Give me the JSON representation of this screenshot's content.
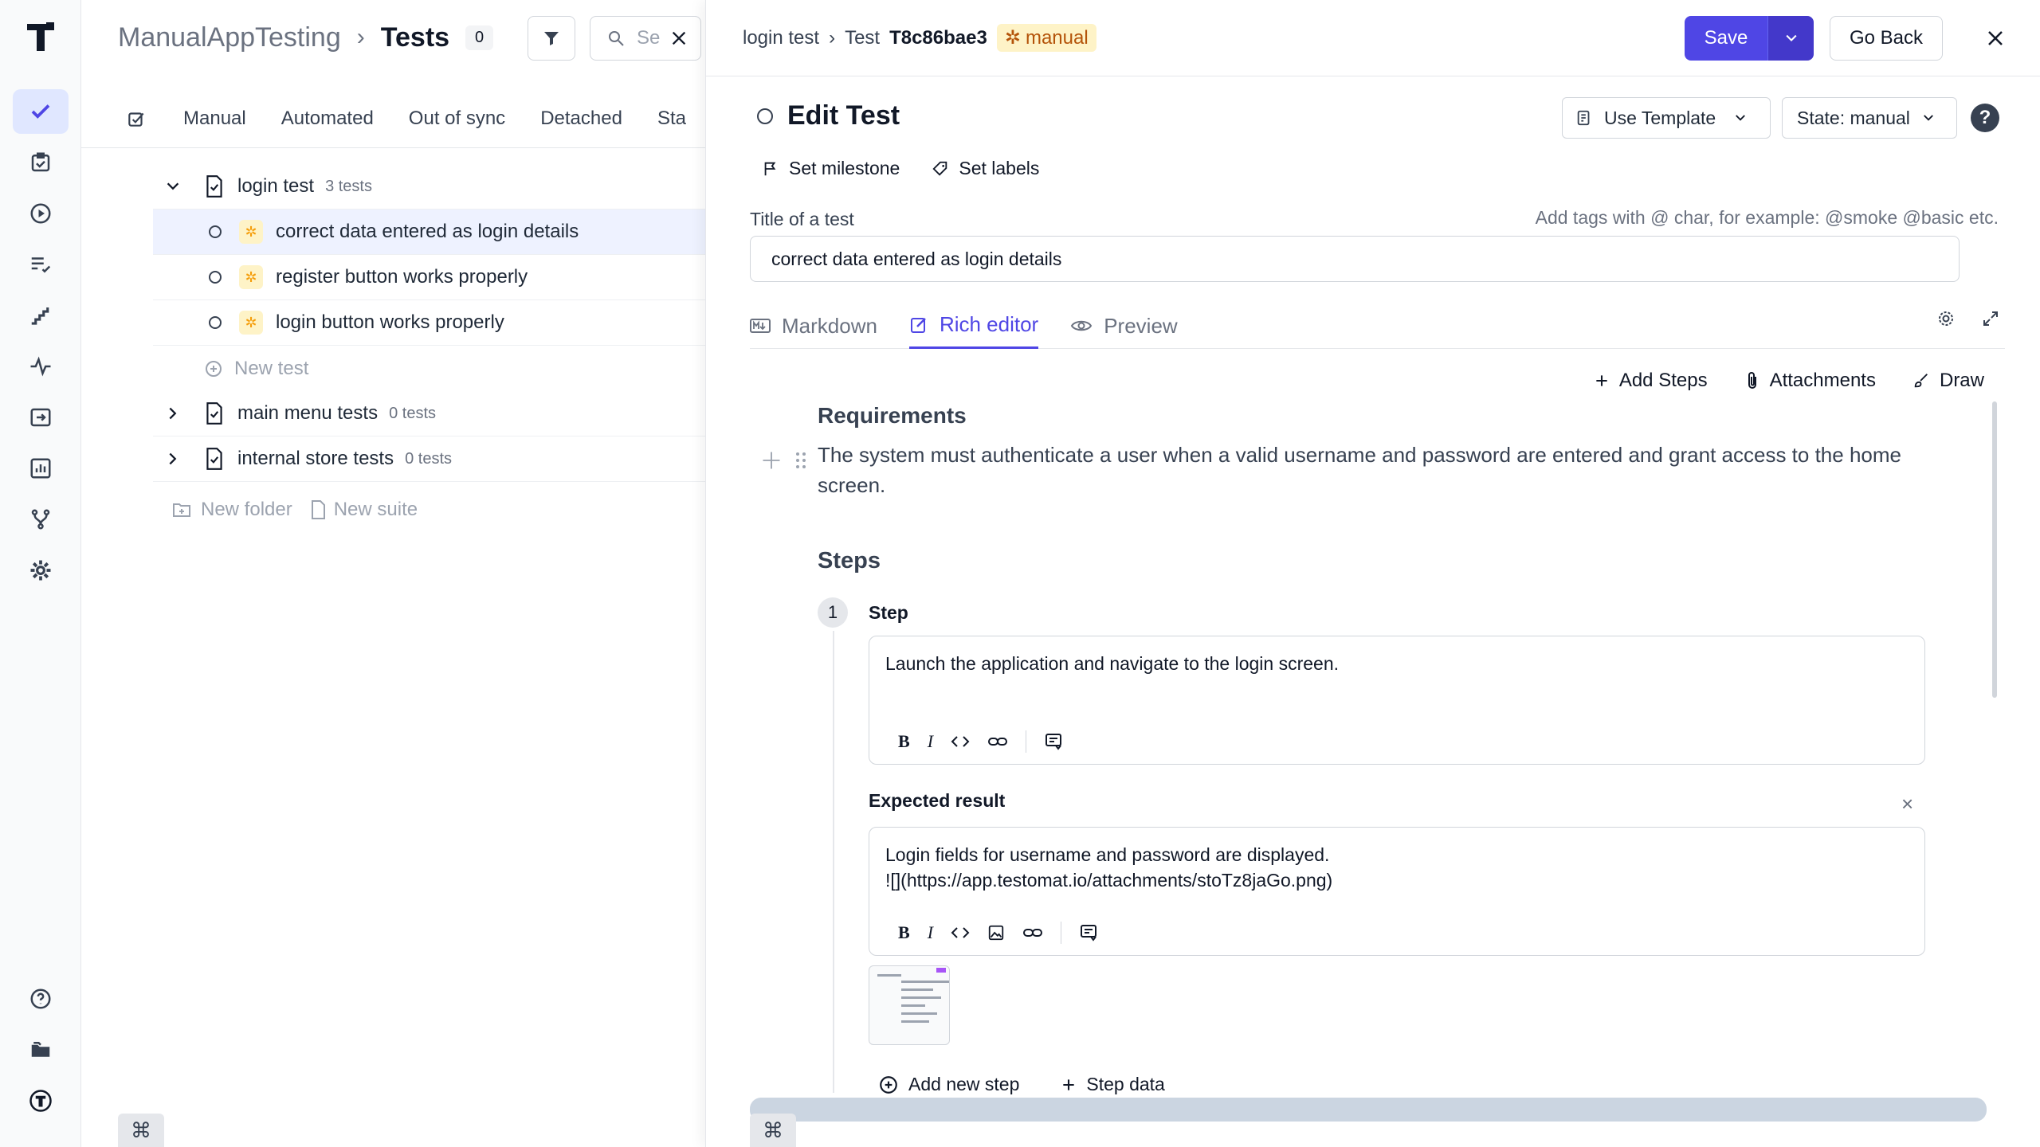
{
  "sidebar": {
    "items": [
      "tests-icon",
      "runs-icon",
      "play-icon",
      "list-icon",
      "steps-icon",
      "pulse-icon",
      "import-icon",
      "analytics-icon",
      "branch-icon",
      "settings-icon"
    ],
    "bottom": [
      "help-icon",
      "folder-icon",
      "user-logo"
    ]
  },
  "left": {
    "project": "ManualAppTesting",
    "separator": "›",
    "section": "Tests",
    "count": "0",
    "search_placeholder": "Se",
    "tabs": [
      "Manual",
      "Automated",
      "Out of sync",
      "Detached",
      "Sta"
    ],
    "tree": {
      "suite": {
        "name": "login test",
        "meta": "3 tests"
      },
      "tests": [
        {
          "name": "correct data entered as login details"
        },
        {
          "name": "register button works properly"
        },
        {
          "name": "login button works properly"
        }
      ],
      "new_test": "New test",
      "other_suites": [
        {
          "name": "main menu tests",
          "meta": "0 tests"
        },
        {
          "name": "internal store tests",
          "meta": "0 tests"
        }
      ],
      "new_folder": "New folder",
      "new_suite": "New suite"
    },
    "cmd_symbol": "⌘"
  },
  "right": {
    "breadcrumb": {
      "suite": "login test",
      "sep": "›",
      "test_prefix": "Test",
      "test_id": "T8c86bae3",
      "badge": "manual"
    },
    "save": "Save",
    "go_back": "Go Back",
    "edit_title": "Edit Test",
    "use_template": "Use Template",
    "state": "State: manual",
    "help": "?",
    "set_milestone": "Set milestone",
    "set_labels": "Set labels",
    "title_label": "Title of a test",
    "tags_hint": "Add tags with @ char, for example: @smoke @basic etc.",
    "title_value": "correct data entered as login details",
    "editor_tabs": [
      "Markdown",
      "Rich editor",
      "Preview"
    ],
    "actions": {
      "add_steps": "Add Steps",
      "attachments": "Attachments",
      "draw": "Draw"
    },
    "requirements_heading": "Requirements",
    "requirements_text": "The system must authenticate a user when a valid username and password are entered and grant access to the home screen.",
    "steps_heading": "Steps",
    "step": {
      "number": "1",
      "label": "Step",
      "text": "Launch the application and navigate to the login screen.",
      "expected_label": "Expected result",
      "expected_line1": "Login fields for username and password are displayed.",
      "expected_line2": "![](https://app.testomat.io/attachments/stoTz8jaGo.png)"
    },
    "add_new_step": "Add new step",
    "step_data": "Step data",
    "cmd_symbol": "⌘"
  },
  "colors": {
    "accent": "#4f46e5",
    "manual_badge": "#fef3c7"
  }
}
